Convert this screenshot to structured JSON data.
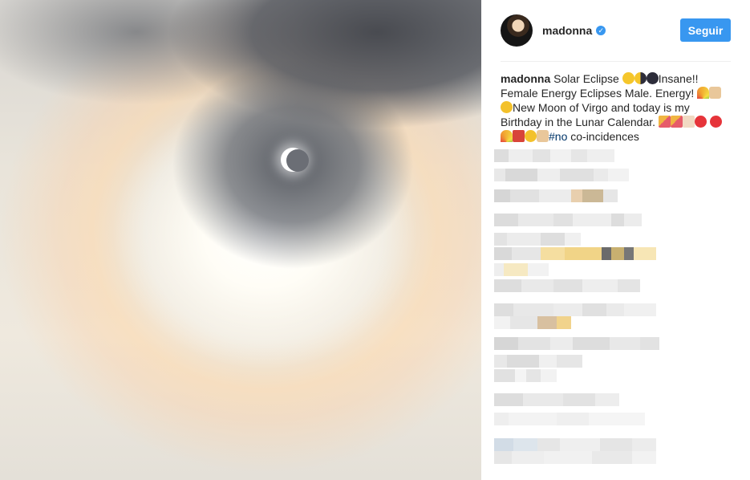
{
  "post": {
    "username": "madonna",
    "verified": true,
    "follow_label": "Seguir",
    "caption": {
      "username": "madonna",
      "seg1": "Solar Eclipse ",
      "seg2": "Insane!!",
      "seg3": "Female Energy Eclipses Male. Energy! ",
      "seg4": "New Moon of Virgo and today is my",
      "seg5": "Birthday in the Lunar Calendar. ",
      "hashtag": "#no",
      "seg6": " co-incidences"
    }
  },
  "icons": {
    "verified": "verified-badge-icon",
    "follow": "follow-button"
  },
  "colors": {
    "accent": "#3897f0",
    "text": "#262626",
    "hashtag": "#003569",
    "divider": "#efefef"
  },
  "comments_note": "pixelated / blurred comment text (not legible)"
}
